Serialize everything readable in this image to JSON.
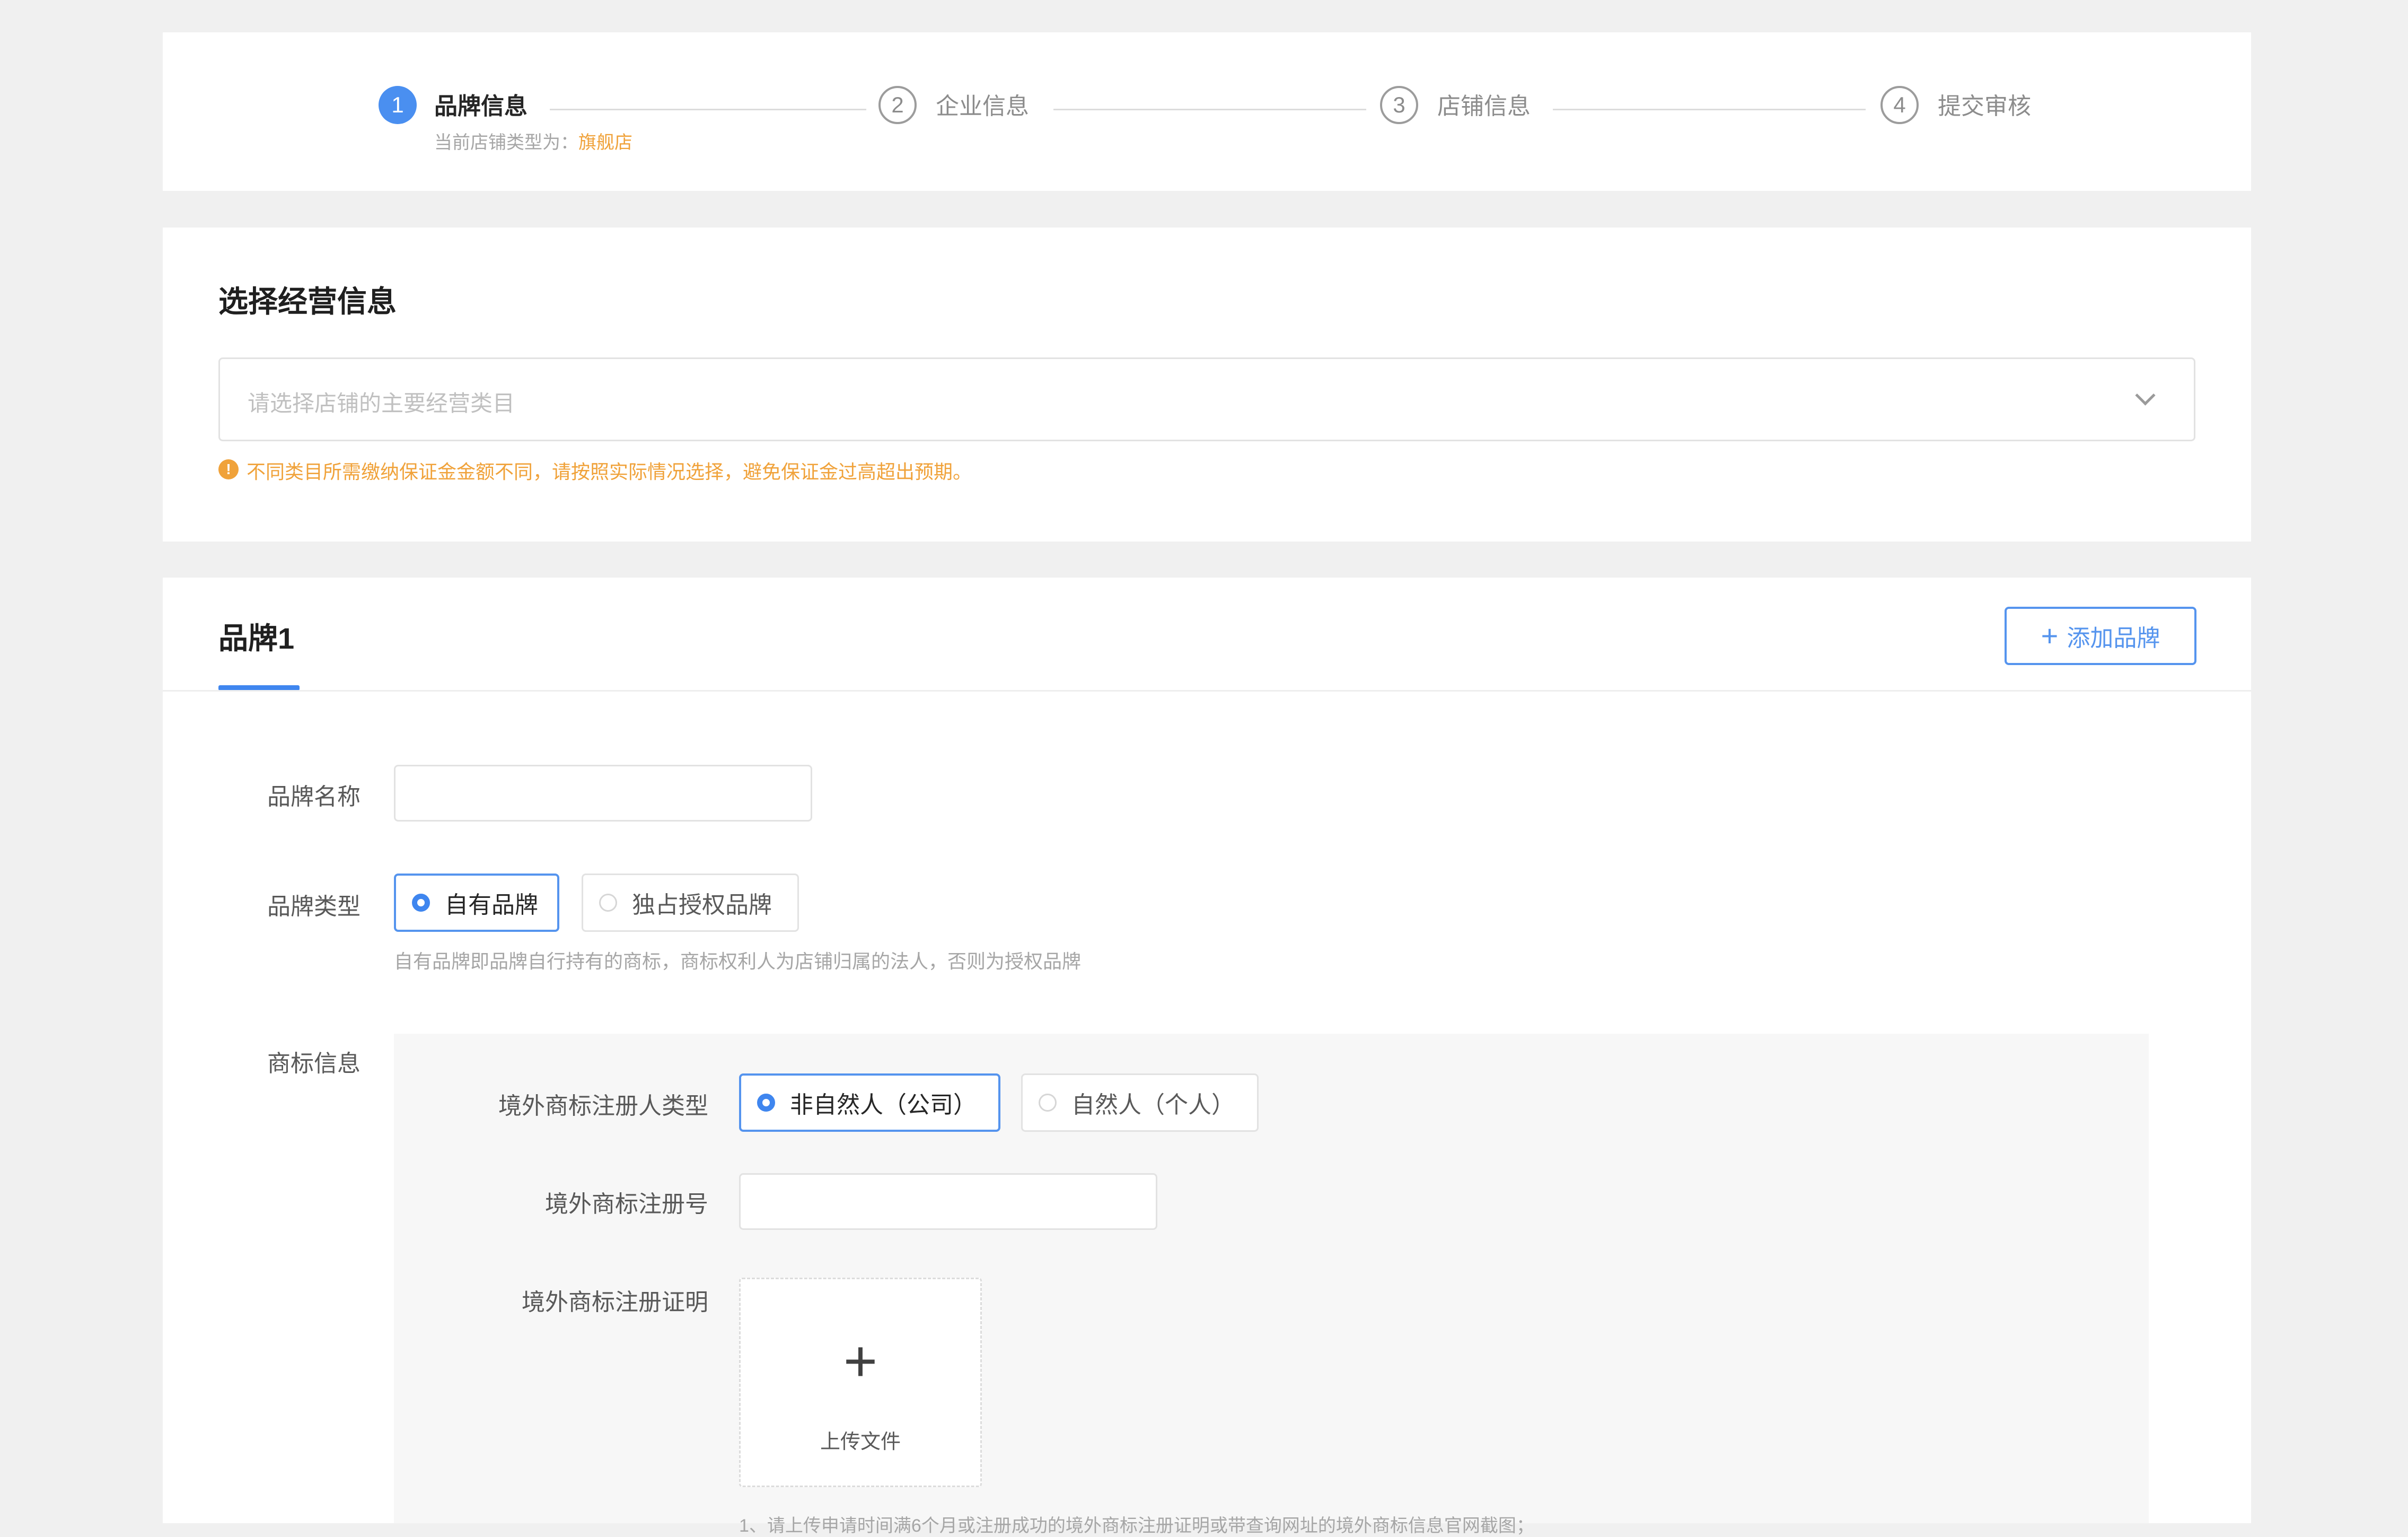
{
  "steps": {
    "items": [
      {
        "number": "1",
        "label": "品牌信息",
        "state": "active"
      },
      {
        "number": "2",
        "label": "企业信息",
        "state": "todo"
      },
      {
        "number": "3",
        "label": "店铺信息",
        "state": "todo"
      },
      {
        "number": "4",
        "label": "提交审核",
        "state": "todo"
      }
    ],
    "subtitle_prefix": "当前店铺类型为：",
    "subtitle_value": "旗舰店"
  },
  "business": {
    "title": "选择经营信息",
    "select_placeholder": "请选择店铺的主要经营类目",
    "warning": "不同类目所需缴纳保证金金额不同，请按照实际情况选择，避免保证金过高超出预期。",
    "warning_icon": "!"
  },
  "brand": {
    "tab_label": "品牌1",
    "add_button_label": "添加品牌",
    "add_button_icon": "+",
    "name_label": "品牌名称",
    "name_value": "",
    "type_label": "品牌类型",
    "type_options": [
      {
        "label": "自有品牌",
        "checked": true
      },
      {
        "label": "独占授权品牌",
        "checked": false
      }
    ],
    "type_hint": "自有品牌即品牌自行持有的商标，商标权利人为店铺归属的法人，否则为授权品牌",
    "trademark": {
      "section_label": "商标信息",
      "registrant_type_label": "境外商标注册人类型",
      "registrant_options": [
        {
          "label": "非自然人（公司）",
          "checked": true
        },
        {
          "label": "自然人（个人）",
          "checked": false
        }
      ],
      "reg_number_label": "境外商标注册号",
      "reg_number_value": "",
      "certificate_label": "境外商标注册证明",
      "upload_icon": "+",
      "upload_label": "上传文件",
      "upload_note": "1、请上传申请时间满6个月或注册成功的境外商标注册证明或带查询网址的境外商标信息官网截图；"
    }
  },
  "colors": {
    "primary": "#3f86ef",
    "warning": "#f0a23a",
    "background": "#f0f0f0"
  }
}
